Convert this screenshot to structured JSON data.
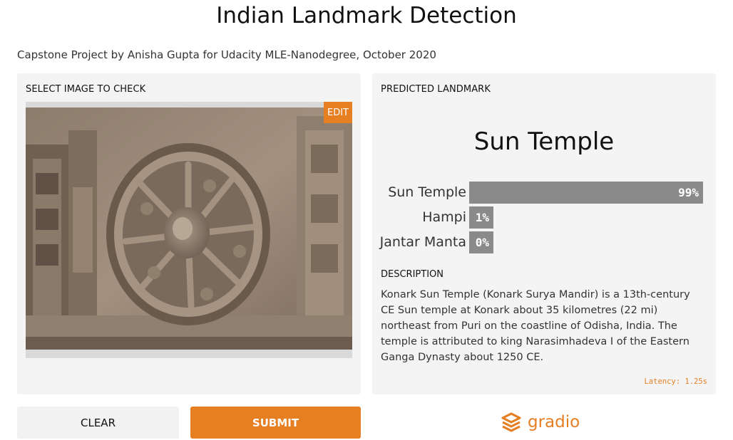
{
  "header": {
    "title": "Indian Landmark Detection",
    "subtitle": "Capstone Project by Anisha Gupta for Udacity MLE-Nanodegree, October 2020"
  },
  "input_panel": {
    "label": "SELECT IMAGE TO CHECK",
    "edit_label": "EDIT",
    "image_subject": "stone chariot wheel of Konark Sun Temple"
  },
  "output_panel": {
    "label": "PREDICTED LANDMARK",
    "prediction": "Sun Temple",
    "confidences": [
      {
        "label": "Sun Temple",
        "value": 0.99,
        "text": "99%"
      },
      {
        "label": "Hampi",
        "value": 0.01,
        "text": "1%"
      },
      {
        "label": "Jantar Manta",
        "value": 0.0,
        "text": "0%"
      }
    ],
    "description_label": "DESCRIPTION",
    "description": "Konark Sun Temple (Konark Surya Mandir) is a 13th-century CE Sun temple at Konark about 35 kilometres (22 mi) northeast from Puri on the coastline of Odisha, India. The temple is attributed to king Narasimhadeva I of the Eastern Ganga Dynasty about 1250 CE.",
    "latency": "Latency: 1.25s"
  },
  "actions": {
    "clear_label": "CLEAR",
    "submit_label": "SUBMIT"
  },
  "footer": {
    "logo_text": "gradio",
    "logo_icon": "gradio-logo-icon"
  },
  "colors": {
    "accent": "#e67e22",
    "bar": "#8a8a8a",
    "panel": "#f4f4f4"
  }
}
